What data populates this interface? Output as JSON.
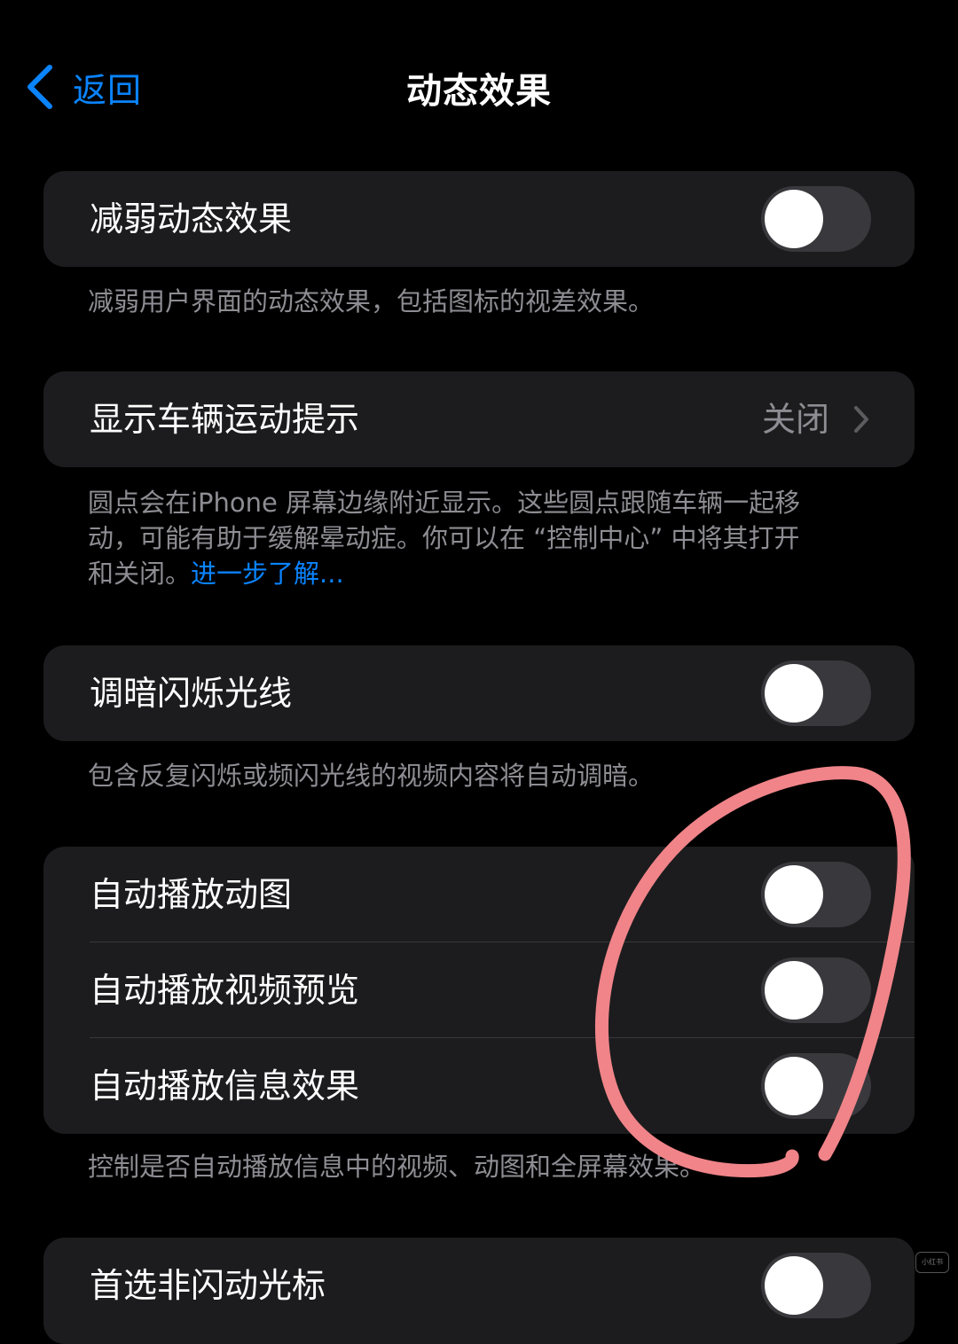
{
  "nav": {
    "back_label": "返回",
    "title": "动态效果"
  },
  "sections": {
    "reduce_motion": {
      "label": "减弱动态效果",
      "on": false,
      "footer": "减弱用户界面的动态效果，包括图标的视差效果。"
    },
    "vehicle_cues": {
      "label": "显示车辆运动提示",
      "value": "关闭",
      "footer_line1": "圆点会在iPhone 屏幕边缘附近显示。这些圆点跟随车辆一起移",
      "footer_line2": "动，可能有助于缓解晕动症。你可以在 “控制中心” 中将其打开",
      "footer_line3": "和关闭。",
      "footer_link": "进一步了解..."
    },
    "dim_flashing": {
      "label": "调暗闪烁光线",
      "on": false,
      "footer": "包含反复闪烁或频闪光线的视频内容将自动调暗。"
    },
    "autoplay": {
      "items": [
        {
          "label": "自动播放动图",
          "on": false
        },
        {
          "label": "自动播放视频预览",
          "on": false
        },
        {
          "label": "自动播放信息效果",
          "on": false
        }
      ],
      "footer": "控制是否自动播放信息中的视频、动图和全屏幕效果。"
    },
    "partial": {
      "label": "首选非闪动光标",
      "on": false
    }
  },
  "colors": {
    "background": "#000000",
    "cell": "#1c1c1e",
    "accent": "#0a84ff",
    "secondary_text": "#8d8d93",
    "toggle_off": "#39393d",
    "annotation": "#f08489"
  },
  "watermark": "小红书"
}
